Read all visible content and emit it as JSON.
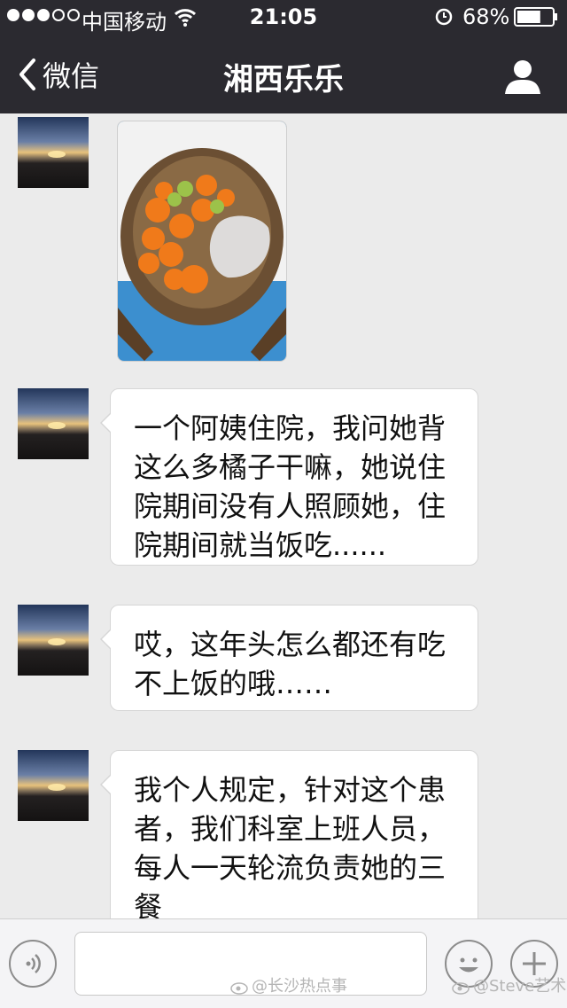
{
  "status_bar": {
    "carrier": "中国移动",
    "time": "21:05",
    "battery": "68%",
    "battery_level": 0.68
  },
  "nav": {
    "back_label": "微信",
    "title": "湘西乐乐",
    "icons": [
      "chevron-left-icon",
      "person-icon"
    ]
  },
  "messages": [
    {
      "type": "image",
      "description_icon": "photo-message"
    },
    {
      "type": "text",
      "text": "一个阿姨住院，我问她背这么多橘子干嘛，她说住院期间没有人照顾她，住院期间就当饭吃......"
    },
    {
      "type": "text",
      "text": "哎，这年头怎么都还有吃不上饭的哦……"
    },
    {
      "type": "text",
      "text": "我个人规定，针对这个患者，我们科室上班人员，每人一天轮流负责她的三餐"
    }
  ],
  "toolbar": {
    "input_value": "",
    "icons": [
      "voice-icon",
      "emoji-icon",
      "plus-icon"
    ]
  },
  "watermarks": [
    "@长沙热点事",
    "@Steve艺术"
  ]
}
